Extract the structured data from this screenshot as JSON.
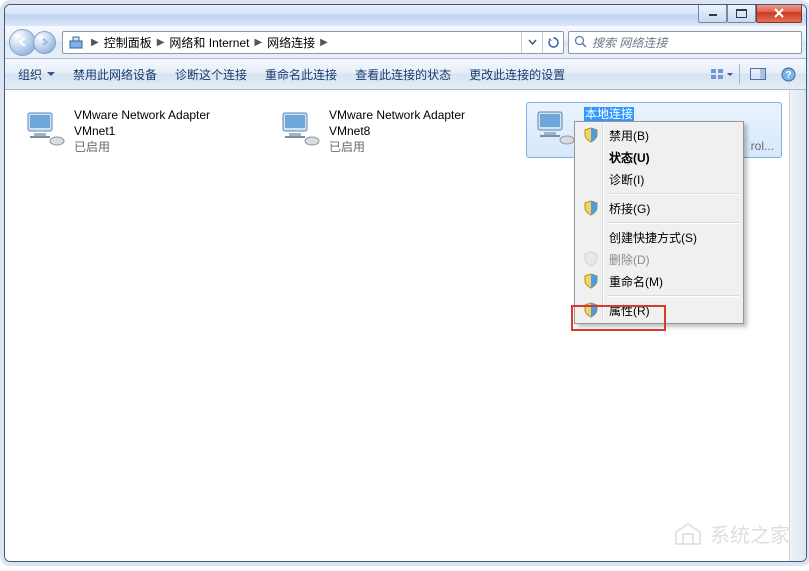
{
  "breadcrumb": {
    "items": [
      "控制面板",
      "网络和 Internet",
      "网络连接"
    ]
  },
  "search": {
    "placeholder": "搜索 网络连接"
  },
  "toolbar": {
    "organize": "组织",
    "b1": "禁用此网络设备",
    "b2": "诊断这个连接",
    "b3": "重命名此连接",
    "b4": "查看此连接的状态",
    "b5": "更改此连接的设置"
  },
  "adapters": [
    {
      "name": "VMware Network Adapter",
      "name2": "VMnet1",
      "status": "已启用"
    },
    {
      "name": "VMware Network Adapter",
      "name2": "VMnet8",
      "status": "已启用"
    },
    {
      "name": "本地连接",
      "name2": "",
      "status": "rol..."
    }
  ],
  "context": {
    "disable": "禁用(B)",
    "status": "状态(U)",
    "diagnose": "诊断(I)",
    "bridge": "桥接(G)",
    "shortcut": "创建快捷方式(S)",
    "delete": "删除(D)",
    "rename": "重命名(M)",
    "properties": "属性(R)"
  },
  "watermark": "系统之家"
}
